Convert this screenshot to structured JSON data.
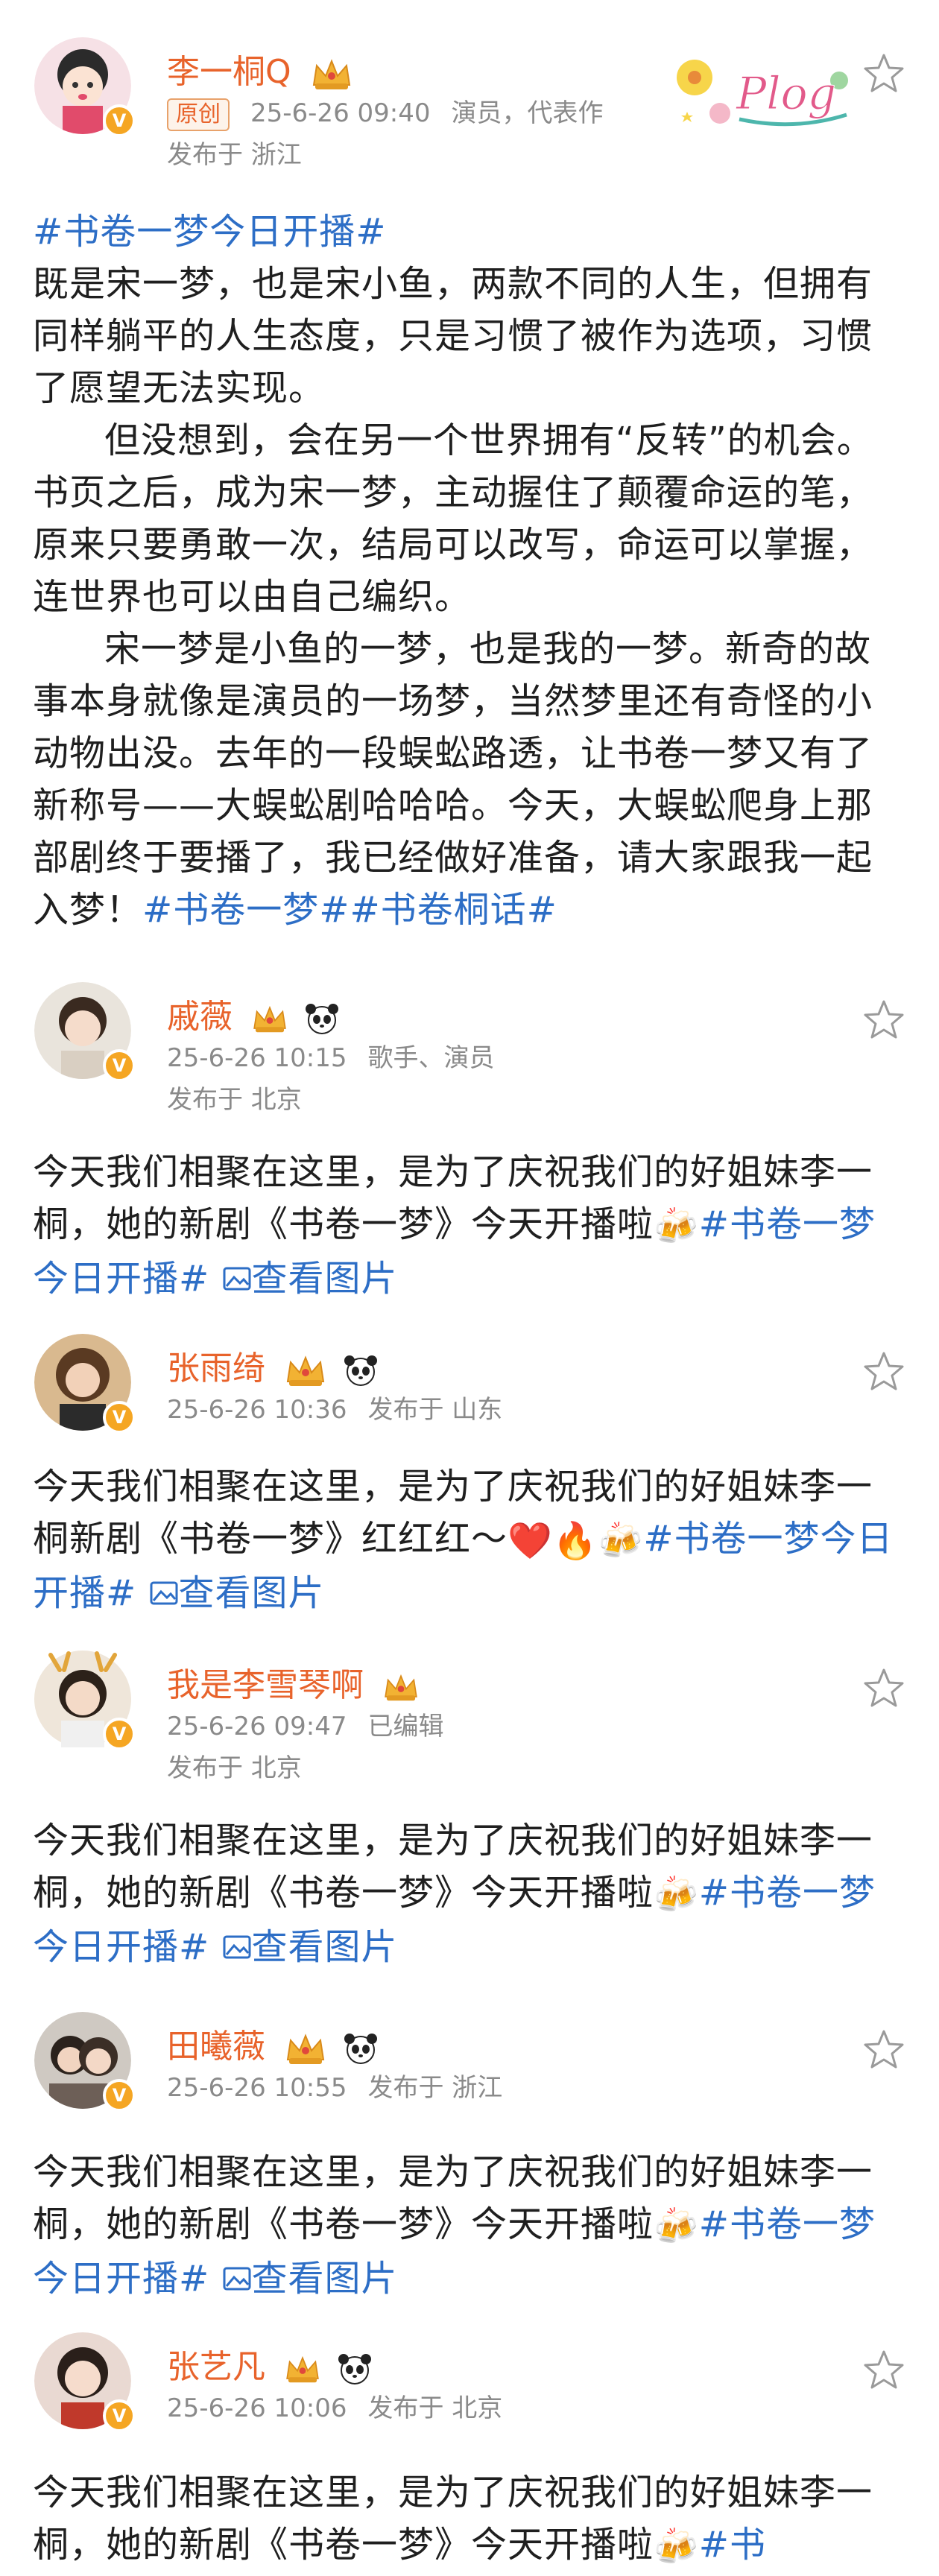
{
  "main_post": {
    "username": "李一桐Q",
    "original_badge": "原创",
    "time": "25-6-26 09:40",
    "tags_meta": "演员，代表作",
    "location": "发布于 浙江",
    "sticker_text": "Plog",
    "hashtag_top": "#书卷一梦今日开播#",
    "paragraph1": "既是宋一梦，也是宋小鱼，两款不同的人生，但拥有同样躺平的人生态度，只是习惯了被作为选项，习惯了愿望无法实现。",
    "paragraph2": "但没想到，会在另一个世界拥有“反转”的机会。书页之后，成为宋一梦，主动握住了颠覆命运的笔，原来只要勇敢一次，结局可以改写，命运可以掌握，连世界也可以由自己编织。",
    "paragraph3": "宋一梦是小鱼的一梦，也是我的一梦。新奇的故事本身就像是演员的一场梦，当然梦里还有奇怪的小动物出没。去年的一段蜈蚣路透，让书卷一梦又有了新称号——大蜈蚣剧哈哈哈。今天，大蜈蚣爬身上那部剧终于要播了，我已经做好准备，请大家跟我一起入梦！",
    "hashtag_end": "#书卷一梦##书卷桐话#"
  },
  "comments": [
    {
      "username": "戚薇",
      "time": "25-6-26 10:15",
      "extra": "歌手、演员",
      "location": "发布于 北京",
      "text": "今天我们相聚在这里，是为了庆祝我们的好姐妹李一桐，她的新剧《书卷一梦》今天开播啦",
      "hashtag": "#书卷一梦今日开播#",
      "image_link": "查看图片"
    },
    {
      "username": "张雨绮",
      "time": "25-6-26 10:36",
      "extra": "",
      "location": "发布于 山东",
      "text": "今天我们相聚在这里，是为了庆祝我们的好姐妹李一桐新剧《书卷一梦》红红红～",
      "hashtag": "#书卷一梦今日开播#",
      "image_link": "查看图片"
    },
    {
      "username": "我是李雪琴啊",
      "time": "25-6-26 09:47",
      "extra": "已编辑",
      "location": "发布于 北京",
      "text": "今天我们相聚在这里，是为了庆祝我们的好姐妹李一桐，她的新剧《书卷一梦》今天开播啦",
      "hashtag": "#书卷一梦今日开播#",
      "image_link": "查看图片"
    },
    {
      "username": "田曦薇",
      "time": "25-6-26 10:55",
      "extra": "",
      "location": "发布于 浙江",
      "text": "今天我们相聚在这里，是为了庆祝我们的好姐妹李一桐，她的新剧《书卷一梦》今天开播啦",
      "hashtag": "#书卷一梦今日开播#",
      "image_link": "查看图片"
    },
    {
      "username": "张艺凡",
      "time": "25-6-26 10:06",
      "extra": "",
      "location": "发布于 北京",
      "text": "今天我们相聚在这里，是为了庆祝我们的好姐妹李一桐，她的新剧《书卷一梦》今天开播啦",
      "hashtag": "#书",
      "image_link": ""
    }
  ],
  "colors": {
    "username": "#e8632b",
    "hashtag": "#2d6ec6",
    "meta": "#8a8a8a",
    "verified": "#f5a623"
  },
  "icons": [
    "favorite-star-icon",
    "verified-badge-icon",
    "crown-icon",
    "panda-icon",
    "image-icon",
    "beer-cheers-icon",
    "heart-icon",
    "fire-icon"
  ]
}
